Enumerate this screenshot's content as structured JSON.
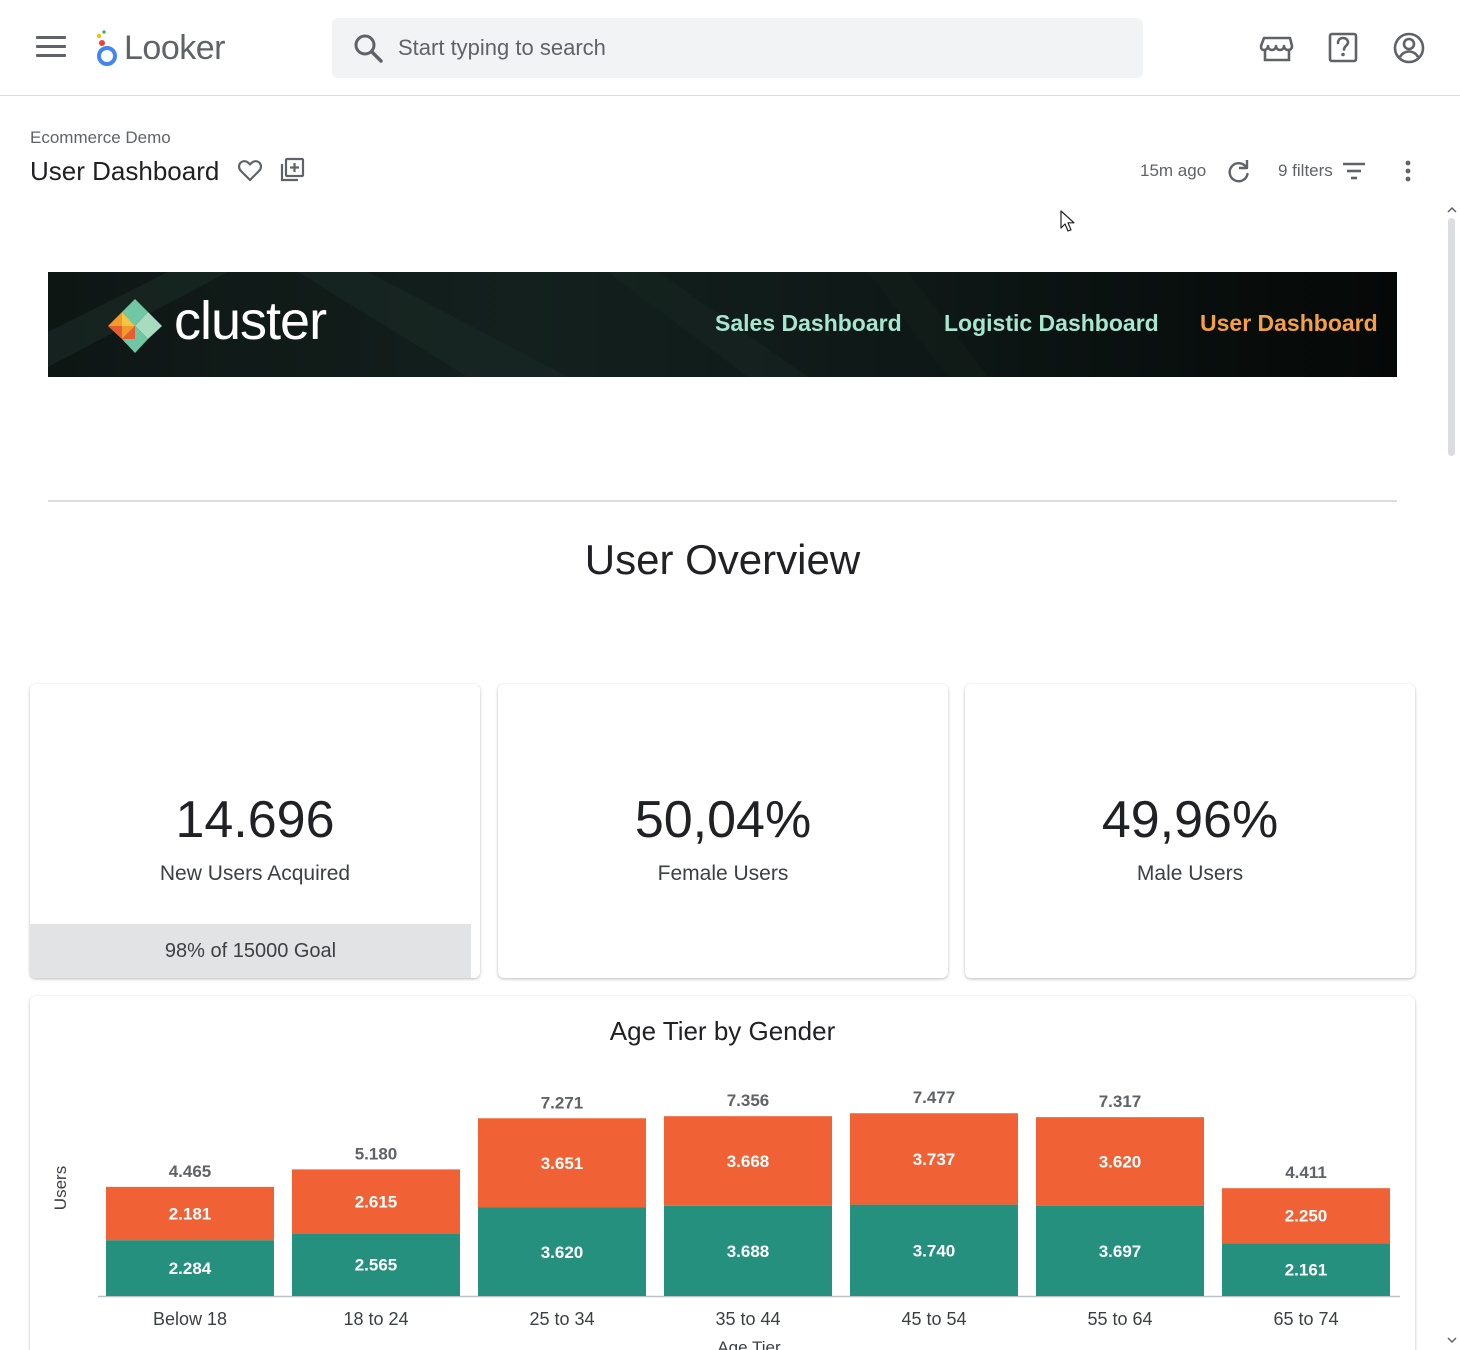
{
  "app": {
    "name": "Looker"
  },
  "search": {
    "placeholder": "Start typing to search"
  },
  "header": {
    "breadcrumb": "Ecommerce Demo",
    "title": "User Dashboard",
    "updated": "15m ago",
    "filters_label": "9 filters"
  },
  "banner": {
    "brand": "cluster",
    "links": [
      {
        "label": "Sales Dashboard",
        "color": "#a8e6cf"
      },
      {
        "label": "Logistic Dashboard",
        "color": "#a8e6cf"
      },
      {
        "label": "User Dashboard",
        "color": "#f5a042",
        "active": true
      }
    ]
  },
  "section": {
    "title": "User Overview"
  },
  "kpis": [
    {
      "value": "14.696",
      "label": "New Users Acquired",
      "footer": "98% of 15000 Goal"
    },
    {
      "value": "50,04%",
      "label": "Female Users"
    },
    {
      "value": "49,96%",
      "label": "Male Users"
    }
  ],
  "colors": {
    "female": "#f06236",
    "male": "#26907f",
    "accent": "#f5a042"
  },
  "chart_data": {
    "type": "bar",
    "stacked": true,
    "title": "Age Tier by Gender",
    "xlabel": "Age Tier",
    "ylabel": "Users",
    "categories": [
      "Below 18",
      "18 to 24",
      "25 to 34",
      "35 to 44",
      "45 to 54",
      "55 to 64",
      "65 to 74"
    ],
    "series": [
      {
        "values": [
          2284,
          2565,
          3620,
          3688,
          3740,
          3697,
          2161
        ],
        "labels": [
          "2.284",
          "2.565",
          "3.620",
          "3.688",
          "3.740",
          "3.697",
          "2.161"
        ],
        "color": "#26907f"
      },
      {
        "values": [
          2181,
          2615,
          3651,
          3668,
          3737,
          3620,
          2250
        ],
        "labels": [
          "2.181",
          "2.615",
          "3.651",
          "3.668",
          "3.737",
          "3.620",
          "2.250"
        ],
        "color": "#f06236"
      }
    ],
    "totals": [
      "4.465",
      "5.180",
      "7.271",
      "7.356",
      "7.477",
      "7.317",
      "4.411"
    ],
    "ylim": [
      0,
      9000
    ],
    "grid": false,
    "legend": "none"
  }
}
